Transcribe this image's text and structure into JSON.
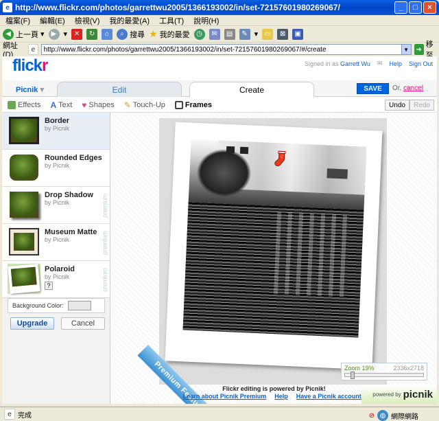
{
  "window": {
    "title": "http://www.flickr.com/photos/garrettwu2005/1366193002/in/set-72157601980269067/"
  },
  "menu": [
    "檔案(F)",
    "編輯(E)",
    "檢視(V)",
    "我的最愛(A)",
    "工具(T)",
    "說明(H)"
  ],
  "toolbar": {
    "back": "上一頁",
    "search": "搜尋",
    "favorites": "我的最愛"
  },
  "address": {
    "label": "網址(D)",
    "url": "http://www.flickr.com/photos/garrettwu2005/1366193002/in/set-72157601980269067/#/create",
    "go": "移至"
  },
  "flickr": {
    "logo_b": "flickr",
    "signed_in": "Signed in as",
    "user": "Garrett Wu",
    "help": "Help",
    "signout": "Sign Out"
  },
  "tabs": {
    "picnik": "Picnik",
    "edit": "Edit",
    "create": "Create",
    "save": "SAVE",
    "or": "Or,",
    "cancel": "cancel"
  },
  "subtabs": [
    "Effects",
    "Text",
    "Shapes",
    "Touch-Up",
    "Frames"
  ],
  "undo": "Undo",
  "redo": "Redo",
  "frames": [
    {
      "name": "Border",
      "by": "by Picnik",
      "premium": false
    },
    {
      "name": "Rounded Edges",
      "by": "by Picnik",
      "premium": false
    },
    {
      "name": "Drop Shadow",
      "by": "by Picnik",
      "premium": true
    },
    {
      "name": "Museum Matte",
      "by": "by Picnik",
      "premium": true
    },
    {
      "name": "Polaroid",
      "by": "by Picnik",
      "premium": true
    }
  ],
  "premium_label": "premium",
  "help_q": "?",
  "bgcolor_label": "Background Color:",
  "upgrade": "Upgrade",
  "cancel_btn": "Cancel",
  "premium_feature": "Premium Feature",
  "powered": {
    "line1": "Flickr editing is powered by Picnik!",
    "learn": "Learn about Picnik Premium",
    "help": "Help",
    "question": "Have a Picnik account?"
  },
  "zoom": {
    "label": "Zoom 19%",
    "dims": "2336x2718",
    "level": 0.19
  },
  "badge": {
    "powered": "powered by",
    "name": "picnik"
  },
  "status": {
    "text": "完成",
    "zone": "網際網路"
  }
}
